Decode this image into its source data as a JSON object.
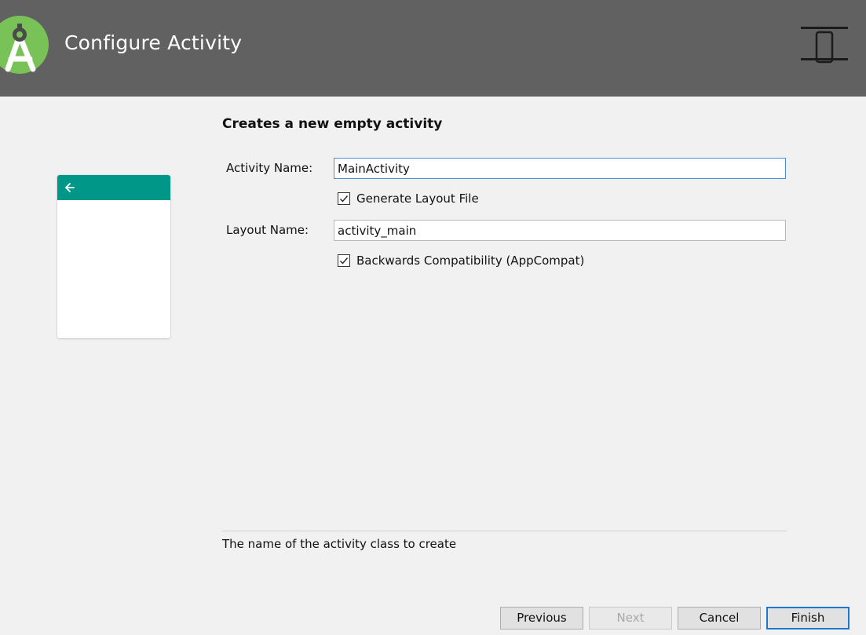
{
  "header": {
    "title": "Configure Activity",
    "logo_icon": "android-studio-logo",
    "device_icon": "phone-device-icon"
  },
  "preview": {
    "appbar_color": "#009688",
    "back_icon": "arrow-left-icon"
  },
  "form": {
    "title": "Creates a new empty activity",
    "activity_name_label": "Activity Name:",
    "activity_name_value": "MainActivity",
    "generate_layout_label": "Generate Layout File",
    "generate_layout_checked": true,
    "layout_name_label": "Layout Name:",
    "layout_name_value": "activity_main",
    "backwards_compat_label": "Backwards Compatibility (AppCompat)",
    "backwards_compat_checked": true
  },
  "help": {
    "text": "The name of the activity class to create"
  },
  "buttons": {
    "previous": "Previous",
    "next": "Next",
    "cancel": "Cancel",
    "finish": "Finish"
  },
  "colors": {
    "header_bg": "#616161",
    "body_bg": "#f1f1f1",
    "focus_border": "#4a8fd4",
    "primary_button_border": "#1e78d2"
  }
}
